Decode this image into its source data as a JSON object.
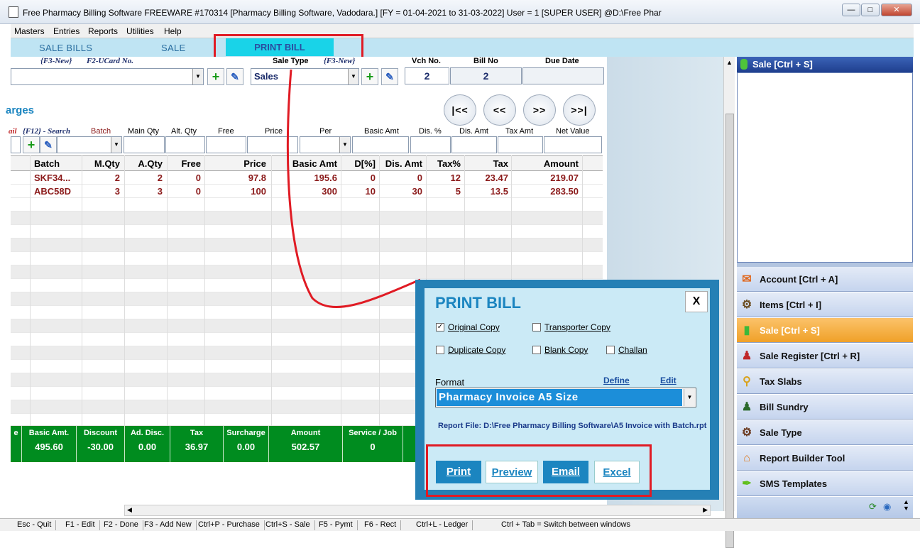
{
  "window": {
    "title": "Free Pharmacy Billing Software FREEWARE   #170314   [Pharmacy Billing Software, Vadodara.] [FY = 01-04-2021 to 31-03-2022] User = 1 [SUPER USER]  @D:\\Free Phar",
    "min_icon": "minimize-icon",
    "max_icon": "maximize-icon",
    "close_icon": "close-icon"
  },
  "menu": [
    "Masters",
    "Entries",
    "Reports",
    "Utilities",
    "Help"
  ],
  "tabs": [
    "SALE BILLS",
    "SALE",
    "PRINT BILL"
  ],
  "header": {
    "f3_new": "{F3-New}",
    "f2_ucard": "F2-UCard No.",
    "sale_type_label": "Sale Type",
    "sale_type_f3": "{F3-New}",
    "sale_type_value": "Sales",
    "vch_no_label": "Vch No.",
    "vch_no": "2",
    "bill_no_label": "Bill No",
    "bill_no": "2",
    "due_date_label": "Due Date",
    "due_date": ""
  },
  "section_title": "arges",
  "nav": [
    "|<<",
    "<<",
    ">>",
    ">>|"
  ],
  "entry_labels": {
    "detail": "ail",
    "search": "{F12} - Search",
    "batch": "Batch",
    "main_qty": "Main Qty",
    "alt_qty": "Alt. Qty",
    "free": "Free",
    "price": "Price",
    "per": "Per",
    "basic_amt": "Basic Amt",
    "dis_pct": "Dis. %",
    "dis_amt": "Dis. Amt",
    "tax_amt": "Tax Amt",
    "net_value": "Net Value"
  },
  "grid": {
    "headers": [
      "Batch",
      "M.Qty",
      "A.Qty",
      "Free",
      "Price",
      "Basic Amt",
      "D[%]",
      "Dis. Amt",
      "Tax%",
      "Tax",
      "Amount"
    ],
    "rows": [
      [
        "SKF34...",
        "2",
        "2",
        "0",
        "97.8",
        "195.6",
        "0",
        "0",
        "12",
        "23.47",
        "219.07"
      ],
      [
        "ABC58D",
        "3",
        "3",
        "0",
        "100",
        "300",
        "10",
        "30",
        "5",
        "13.5",
        "283.50"
      ]
    ]
  },
  "totals": [
    {
      "label": "e",
      "value": ""
    },
    {
      "label": "Basic Amt.",
      "value": "495.60"
    },
    {
      "label": "Discount",
      "value": "-30.00"
    },
    {
      "label": "Ad. Disc.",
      "value": "0.00"
    },
    {
      "label": "Tax",
      "value": "36.97"
    },
    {
      "label": "Surcharge",
      "value": "0.00"
    },
    {
      "label": "Amount",
      "value": "502.57"
    },
    {
      "label": "Service / Job",
      "value": "0"
    }
  ],
  "right_panel": {
    "header": "Sale [Ctrl + S]",
    "items": [
      {
        "label": "Account [Ctrl + A]",
        "icon": "account-icon"
      },
      {
        "label": "Items [Ctrl + I]",
        "icon": "items-icon"
      },
      {
        "label": "Sale [Ctrl + S]",
        "icon": "sale-icon",
        "active": true
      },
      {
        "label": "Sale Register [Ctrl + R]",
        "icon": "sale-register-icon"
      },
      {
        "label": "Tax Slabs",
        "icon": "tax-slabs-icon"
      },
      {
        "label": "Bill Sundry",
        "icon": "bill-sundry-icon"
      },
      {
        "label": "Sale Type",
        "icon": "sale-type-icon"
      },
      {
        "label": "Report Builder Tool",
        "icon": "report-builder-icon"
      },
      {
        "label": "SMS Templates",
        "icon": "sms-templates-icon"
      }
    ]
  },
  "status_bar": [
    "Esc - Quit",
    "F1 - Edit",
    "F2 - Done",
    "F3 - Add New",
    "Ctrl+P - Purchase",
    "Ctrl+S - Sale",
    "F5 - Pymt",
    "F6 - Rect",
    "Ctrl+L - Ledger",
    "Ctrl + Tab = Switch between windows"
  ],
  "dialog": {
    "title": "PRINT BILL",
    "close": "X",
    "checkboxes": [
      {
        "label": "Original Copy",
        "checked": true
      },
      {
        "label": "Transporter Copy",
        "checked": false
      },
      {
        "label": "Duplicate Copy",
        "checked": false
      },
      {
        "label": "Blank Copy",
        "checked": false
      },
      {
        "label": "Challan",
        "checked": false
      }
    ],
    "format_label": "Format",
    "define": "Define",
    "edit": "Edit",
    "format_value": "Pharmacy Invoice A5 Size",
    "report_file": "Report File: D:\\Free Pharmacy Billing Software\\A5 Invoice with Batch.rpt",
    "buttons": [
      "Print",
      "Preview",
      "Email",
      "Excel"
    ]
  },
  "colors": {
    "accent": "#1b85c0",
    "active_tab": "#19d3e8",
    "totals_bg": "#008c1f",
    "highlight": "#e01b24",
    "active_item": "#f0a128"
  }
}
